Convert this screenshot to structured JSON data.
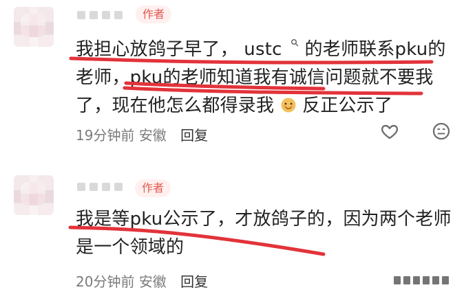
{
  "comments": [
    {
      "badge": "作者",
      "text_parts": {
        "part1": "我担心放鸽子早了，",
        "ustc": "ustc",
        "part2": "的老师联系pku的老师，pku的老师知道我有诚信问题就不要我了，现在他怎么都得录我",
        "part3": "反正公示了"
      },
      "time": "19分钟前",
      "location": "安徽",
      "reply": "回复",
      "icons": {
        "like": "heart-icon",
        "dislike": "neutral-face-icon",
        "search": "search-icon",
        "emoji": "emoji-face-icon"
      }
    },
    {
      "badge": "作者",
      "text": "我是等pku公示了，才放鸽子的，因为两个老师是一个领域的",
      "time": "20分钟前",
      "location": "安徽",
      "reply": "回复"
    }
  ],
  "accent": "#e1584f",
  "underline_color": "#e2333a"
}
